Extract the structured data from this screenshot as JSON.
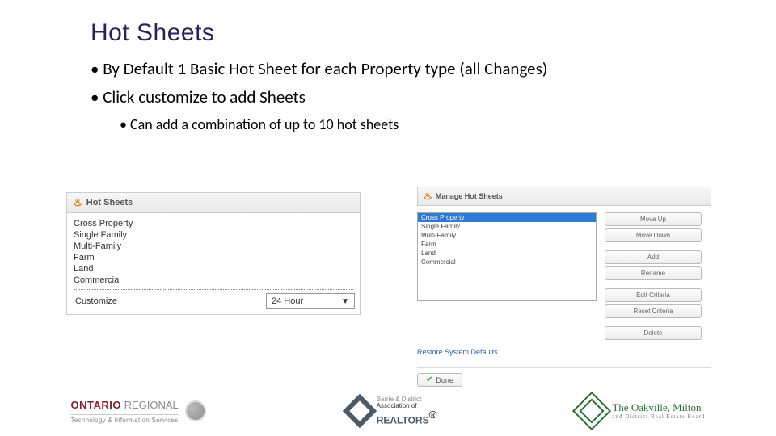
{
  "title": "Hot Sheets",
  "bullets": {
    "b1a": "By Default 1 Basic Hot Sheet for each Property type (all Changes)",
    "b1b": "Click customize to add Sheets",
    "b2a": "Can add a combination of up to 10 hot sheets"
  },
  "hotSheetsPanel": {
    "header": "Hot Sheets",
    "items": [
      "Cross Property",
      "Single Family",
      "Multi-Family",
      "Farm",
      "Land",
      "Commercial"
    ],
    "customize": "Customize",
    "timeRange": "24 Hour"
  },
  "managePanel": {
    "header": "Manage Hot Sheets",
    "items": [
      "Cross Property",
      "Single Family",
      "Multi-Family",
      "Farm",
      "Land",
      "Commercial"
    ],
    "selectedIndex": 0,
    "buttons": {
      "moveUp": "Move Up",
      "moveDown": "Move Down",
      "add": "Add",
      "rename": "Rename",
      "editCriteria": "Edit Criteria",
      "resetCriteria": "Reset Criteria",
      "delete": "Delete"
    },
    "restore": "Restore System Defaults",
    "done": "Done"
  },
  "logos": {
    "l1": {
      "line1a": "ONTARIO",
      "line1b": " REGIONAL",
      "line2": "Technology & Information Services"
    },
    "l2": {
      "line1": "Barrie & District",
      "line2": "Association of",
      "line3": "REALTORS",
      "reg": "®"
    },
    "l3": {
      "line1": "The Oakville, Milton",
      "line2": "and District Real Estate Board"
    }
  }
}
